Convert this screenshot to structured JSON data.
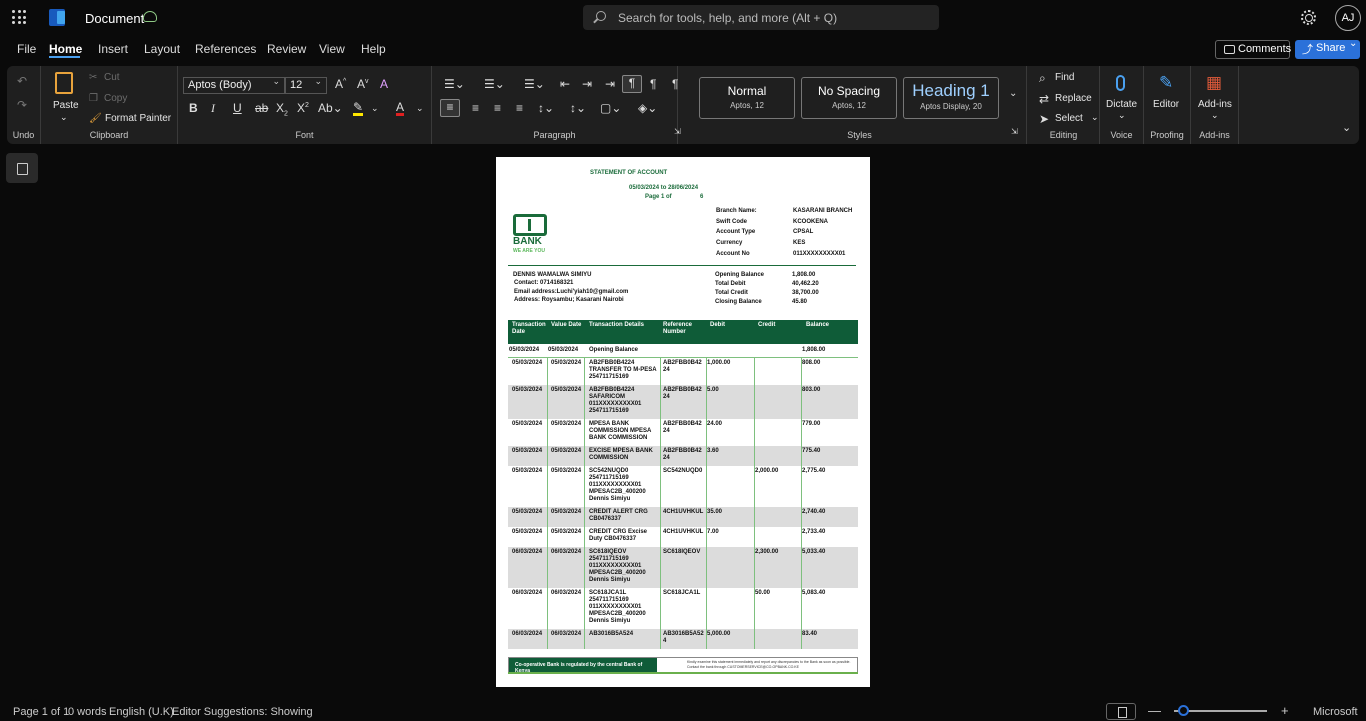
{
  "titlebar": {
    "doc_title": "Document",
    "search_placeholder": "Search for tools, help, and more (Alt + Q)",
    "avatar": "AJ"
  },
  "menu": {
    "tabs": [
      "File",
      "Home",
      "Insert",
      "Layout",
      "References",
      "Review",
      "View",
      "Help"
    ],
    "comments": "Comments",
    "share": "Share"
  },
  "ribbon": {
    "undo_group": "Undo",
    "clipboard": {
      "paste": "Paste",
      "cut": "Cut",
      "copy": "Copy",
      "format_painter": "Format Painter",
      "label": "Clipboard"
    },
    "font": {
      "name": "Aptos (Body)",
      "size": "12",
      "label": "Font"
    },
    "paragraph": {
      "label": "Paragraph"
    },
    "styles": {
      "normal": "Normal",
      "normal_sub": "Aptos, 12",
      "nospacing": "No Spacing",
      "nospacing_sub": "Aptos, 12",
      "heading1": "Heading 1",
      "heading1_sub": "Aptos Display, 20",
      "label": "Styles"
    },
    "editing": {
      "find": "Find",
      "replace": "Replace",
      "select": "Select",
      "label": "Editing"
    },
    "voice": {
      "dictate": "Dictate",
      "label": "Voice"
    },
    "proofing": {
      "editor": "Editor",
      "label": "Proofing"
    },
    "addins": {
      "addins": "Add-ins",
      "label": "Add-ins"
    }
  },
  "doc": {
    "heading": "STATEMENT OF ACCOUNT",
    "period": "05/03/2024 to 28/06/2024",
    "page_label": "Page 1 of",
    "page_total": "6",
    "bank_word": "BANK",
    "bank_tagline": "WE ARE YOU",
    "branch_info": [
      {
        "k": "Branch Name:",
        "v": "KASARANI BRANCH"
      },
      {
        "k": "Swift Code",
        "v": "KCOOKENA"
      },
      {
        "k": "Account Type",
        "v": "CPSAL"
      },
      {
        "k": "Currency",
        "v": "KES"
      },
      {
        "k": "Account No",
        "v": "011XXXXXXXXX01"
      }
    ],
    "customer_name": "DENNIS WAMALWA SIMIYU",
    "contact": "Contact: 0714168321",
    "email": "Email address:Luchi'yiah10@gmail.com",
    "address": "Address: Roysambu; Kasarani Nairobi",
    "balances": [
      {
        "k": "Opening Balance",
        "v": "1,808.00"
      },
      {
        "k": "Total Debit",
        "v": "40,462.20"
      },
      {
        "k": "Total Credit",
        "v": "38,700.00"
      },
      {
        "k": "Closing Balance",
        "v": "45.80"
      }
    ],
    "columns": [
      "Transaction Date",
      "Value Date",
      "Transaction Details",
      "Reference Number",
      "Debit",
      "Credit",
      "Balance"
    ],
    "opening_row": {
      "tdate": "05/03/2024",
      "vdate": "05/03/2024",
      "details": "Opening Balance",
      "balance": "1,808.00"
    },
    "rows": [
      {
        "tdate": "05/03/2024",
        "vdate": "05/03/2024",
        "details": [
          "AB2FBB0B4224",
          "TRANSFER TO M-PESA",
          "254711715169"
        ],
        "ref": [
          "AB2FBB0B42",
          "24"
        ],
        "debit": "1,000.00",
        "credit": "",
        "balance": "808.00"
      },
      {
        "tdate": "05/03/2024",
        "vdate": "05/03/2024",
        "details": [
          "AB2FBB0B4224",
          "SAFARICOM",
          "011XXXXXXXXX01",
          "254711715169"
        ],
        "ref": [
          "AB2FBB0B42",
          "24"
        ],
        "debit": "5.00",
        "credit": "",
        "balance": "803.00"
      },
      {
        "tdate": "05/03/2024",
        "vdate": "05/03/2024",
        "details": [
          "MPESA BANK",
          "COMMISSION MPESA",
          "BANK COMMISSION"
        ],
        "ref": [
          "AB2FBB0B42",
          "24"
        ],
        "debit": "24.00",
        "credit": "",
        "balance": "779.00"
      },
      {
        "tdate": "05/03/2024",
        "vdate": "05/03/2024",
        "details": [
          "EXCISE MPESA BANK",
          "COMMISSION"
        ],
        "ref": [
          "AB2FBB0B42",
          "24"
        ],
        "debit": "3.60",
        "credit": "",
        "balance": "775.40"
      },
      {
        "tdate": "05/03/2024",
        "vdate": "05/03/2024",
        "details": [
          "SC542NUQD0",
          "254711715169",
          "011XXXXXXXXX01",
          "MPESAC2B_400200",
          "Dennis Simiyu"
        ],
        "ref": [
          "SC542NUQD0"
        ],
        "debit": "",
        "credit": "2,000.00",
        "balance": "2,775.40"
      },
      {
        "tdate": "05/03/2024",
        "vdate": "05/03/2024",
        "details": [
          "CREDIT ALERT CRG",
          "CB0476337"
        ],
        "ref": [
          "4CH1UVHKUL"
        ],
        "debit": "35.00",
        "credit": "",
        "balance": "2,740.40"
      },
      {
        "tdate": "05/03/2024",
        "vdate": "05/03/2024",
        "details": [
          "CREDIT CRG Excise",
          "Duty CB0476337"
        ],
        "ref": [
          "4CH1UVHKUL"
        ],
        "debit": "7.00",
        "credit": "",
        "balance": "2,733.40"
      },
      {
        "tdate": "06/03/2024",
        "vdate": "06/03/2024",
        "details": [
          "SC618IQEOV",
          "254711715169",
          "011XXXXXXXXX01",
          "MPESAC2B_400200",
          "Dennis Simiyu"
        ],
        "ref": [
          "SC618IQEOV"
        ],
        "debit": "",
        "credit": "2,300.00",
        "balance": "5,033.40"
      },
      {
        "tdate": "06/03/2024",
        "vdate": "06/03/2024",
        "details": [
          "SC618JCA1L",
          "254711715169",
          "011XXXXXXXXX01",
          "MPESAC2B_400200",
          "Dennis Simiyu"
        ],
        "ref": [
          "SC618JCA1L"
        ],
        "debit": "",
        "credit": "50.00",
        "balance": "5,083.40"
      },
      {
        "tdate": "06/03/2024",
        "vdate": "06/03/2024",
        "details": [
          "AB3016B5A524"
        ],
        "ref": [
          "AB3016B5A52",
          "4"
        ],
        "debit": "5,000.00",
        "credit": "",
        "balance": "83.40"
      }
    ],
    "footer": "Co-operative Bank is regulated by the central Bank of Kenya",
    "footer_note": "Kindly examine this statement immediately and report any discrepancies to the Bank as soon as possible. Contact the bank through CUSTOMERSERVICE@CO-OPBANK.CO.KE"
  },
  "status": {
    "page": "Page 1 of 1",
    "words": "0 words",
    "language": "English (U.K)",
    "suggestions": "Editor Suggestions: Showing",
    "brand": "Microsoft"
  }
}
